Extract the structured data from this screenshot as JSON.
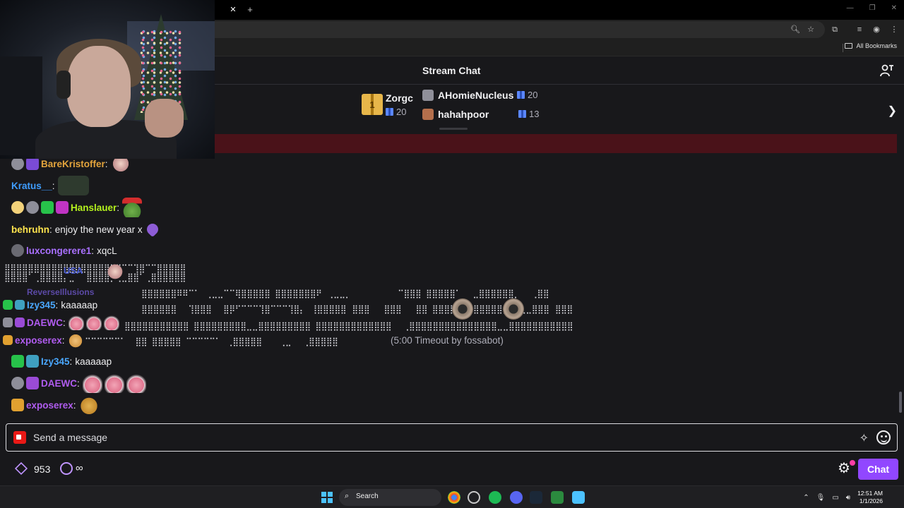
{
  "browser": {
    "bookmarks_label": "All Bookmarks"
  },
  "chat": {
    "title": "Stream Chat"
  },
  "leaderboard": {
    "top": {
      "rank": "1",
      "name": "Zorgc",
      "gifts": "20"
    },
    "entries": [
      {
        "rank_badge": "2",
        "name": "AHomieNucleus",
        "gifts": "20"
      },
      {
        "rank_badge": "3",
        "name": "hahahpoor",
        "gifts": "13"
      }
    ]
  },
  "messages": [
    {
      "user": "BareKristoffer",
      "color": "#e3a43c",
      "text": ""
    },
    {
      "user": "Kratus__",
      "color": "#3f9dff",
      "text": ""
    },
    {
      "user": "Hanslauer",
      "color": "#b5f21e",
      "text": ""
    },
    {
      "user": "behruhn",
      "color": "#ffe44d",
      "text": "enjoy the new year x"
    },
    {
      "user": "luxcongerere1",
      "color": "#a970ff",
      "text": "xqcL"
    },
    {
      "user": "Izy345",
      "color": "#4aa8ff",
      "text": "kaaaaap"
    },
    {
      "user": "DAEWC",
      "color": "#b05cf0",
      "text": ""
    },
    {
      "user": "exposerex",
      "color": "#b05cf0",
      "text": ""
    }
  ],
  "spam": {
    "timeout_text": "(5:00 Timeout by fossabot)",
    "user_a": "Izy345",
    "user_a_text": "kaaaaap",
    "user_b": "DAEWC",
    "user_c": "exposerex",
    "user_d": "ReverseIllusions",
    "user_e": "USA"
  },
  "input": {
    "placeholder": "Send a message"
  },
  "footer": {
    "points": "953",
    "infinite": "∞",
    "chat_button": "Chat"
  },
  "taskbar": {
    "search_label": "Search",
    "time": "12:51 AM",
    "date": "1/1/2026"
  },
  "colors": {
    "accent": "#9147ff",
    "background": "#18181b",
    "banner": "#4a1219"
  }
}
